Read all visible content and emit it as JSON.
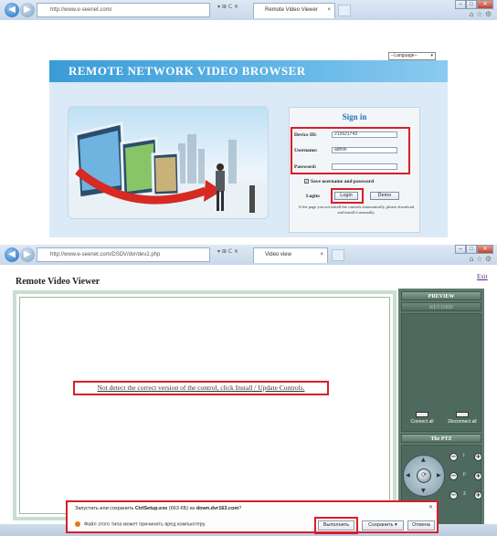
{
  "window1": {
    "address": "http://www.e-seenet.com/",
    "address_controls": "▾ ⊞ C ✕",
    "tab_title": "Remote Video Viewer",
    "window_controls": [
      "–",
      "□",
      "✕"
    ],
    "language_select": "--Language--",
    "banner_title": "REMOTE NETWORK VIDEO BROWSER",
    "signin": {
      "title": "Sign in",
      "device_id_label": "Device ID:",
      "device_id_value": "212621743",
      "username_label": "Username:",
      "username_value": "admin",
      "password_label": "Password:",
      "password_value": "",
      "save_label": "Save username and password",
      "login_label": "Login:",
      "login_button": "Login",
      "demo_button": "Demo",
      "note": "If the page you not install the controls automatically, please download and install it manually."
    }
  },
  "window2": {
    "address": "http://www.e-seenet.com/DSDV/dvr/dev2.php",
    "address_controls": "▾ ⊞ C ✕",
    "tab_title": "Video view",
    "window_controls": [
      "–",
      "□",
      "✕"
    ],
    "page_title": "Remote Video Viewer",
    "exit_link": "Exit",
    "notice": "Not detect the correct version of the control, click Install / Update Controls.",
    "panel": {
      "preview": "PREVIEW",
      "record": "RECORD",
      "connect_all": "Connect all",
      "disconnect_all": "Disconnect all",
      "ptz": "The PTZ",
      "zoom_labels": [
        "I",
        "F",
        "Z"
      ]
    },
    "download_bar": {
      "prefix": "Запустить или сохранить",
      "file": "CtrlSetup.exe",
      "size": "(663 КБ)",
      "from": "из",
      "host": "down.dvr163.com",
      "suffix": "?",
      "warning": "Файл этого типа может причинить вред компьютеру.",
      "run": "Выполнить",
      "save": "Сохранить",
      "cancel": "Отмена"
    }
  }
}
